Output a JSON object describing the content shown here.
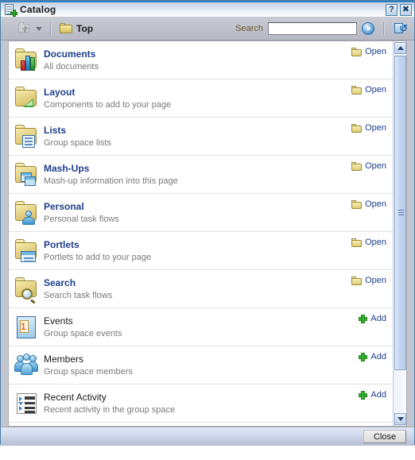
{
  "window": {
    "title": "Catalog",
    "icon": "catalog-add-icon",
    "help_label": "?",
    "close_label": "✖"
  },
  "toolbar": {
    "up_folder_icon": "up-one-folder-icon",
    "dropdown_icon": "chevron-down-icon",
    "breadcrumb_label": "Top",
    "breadcrumb_icon": "folder-icon",
    "search_label": "Search",
    "search_value": "",
    "search_placeholder": "",
    "go_icon": "go-arrow-icon",
    "refresh_icon": "refresh-icon"
  },
  "list": {
    "rows": [
      {
        "title": "Documents",
        "desc": "All documents",
        "action": "Open",
        "action_type": "open",
        "icon": "folder-documents-icon",
        "style": "link"
      },
      {
        "title": "Layout",
        "desc": "Components to add to your page",
        "action": "Open",
        "action_type": "open",
        "icon": "folder-layout-icon",
        "style": "link"
      },
      {
        "title": "Lists",
        "desc": "Group space lists",
        "action": "Open",
        "action_type": "open",
        "icon": "folder-lists-icon",
        "style": "link"
      },
      {
        "title": "Mash-Ups",
        "desc": "Mash-up information into this page",
        "action": "Open",
        "action_type": "open",
        "icon": "folder-mashups-icon",
        "style": "link"
      },
      {
        "title": "Personal",
        "desc": "Personal task flows",
        "action": "Open",
        "action_type": "open",
        "icon": "folder-personal-icon",
        "style": "link"
      },
      {
        "title": "Portlets",
        "desc": "Portlets to add to your page",
        "action": "Open",
        "action_type": "open",
        "icon": "folder-portlets-icon",
        "style": "link"
      },
      {
        "title": "Search",
        "desc": "Search task flows",
        "action": "Open",
        "action_type": "open",
        "icon": "folder-search-icon",
        "style": "link"
      },
      {
        "title": "Events",
        "desc": "Group space events",
        "action": "Add",
        "action_type": "add",
        "icon": "events-icon",
        "style": "plain"
      },
      {
        "title": "Members",
        "desc": "Group space members",
        "action": "Add",
        "action_type": "add",
        "icon": "members-icon",
        "style": "plain"
      },
      {
        "title": "Recent Activity",
        "desc": "Recent activity in the group space",
        "action": "Add",
        "action_type": "add",
        "icon": "recent-activity-icon",
        "style": "plain"
      }
    ]
  },
  "scrollbar": {
    "up_icon": "scroll-up-icon",
    "down_icon": "scroll-down-icon",
    "thumb_grip_icon": "scroll-thumb-grip-icon"
  },
  "footer": {
    "close_label": "Close"
  },
  "colors": {
    "title_accent": "#2f7fc0",
    "link": "#1d3f8c",
    "toolbar_bg": "#bec1cb",
    "folder_yellow": "#e3d07a",
    "add_green": "#3aae33"
  }
}
